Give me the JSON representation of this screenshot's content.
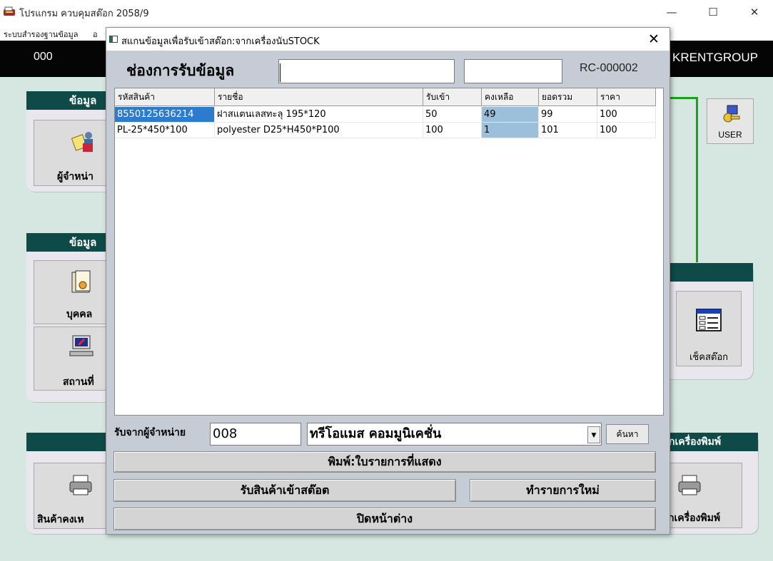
{
  "window": {
    "title": "โปรแกรม ควบคุมสต๊อก 2058/9",
    "minimize": "—",
    "maximize": "☐",
    "close": "✕"
  },
  "menu": [
    "ระบบสำรองฐานข้อมูล",
    "อ"
  ],
  "header_bar": {
    "left_text": "000",
    "right_text": "KRENTGROUP"
  },
  "panels": {
    "panel1": {
      "heading": "ข้อมูล",
      "tile_label": "ผู้จำหน่า"
    },
    "panel2": {
      "heading": "ข้อมูล",
      "tile1_label": "บุคคล",
      "tile2_label": "สถานที่"
    },
    "panel3": {
      "tile_label": "สินค้าคงเห"
    },
    "right_top": {
      "user_label": "USER"
    },
    "right_mid": {
      "tile_label": "เช็คสต๊อก"
    },
    "right_bottom": {
      "heading": "กเครื่องพิมพ์",
      "tile_label": "กเครื่องพิมพ์"
    }
  },
  "dialog": {
    "title": "สแกนข้อมูลเพื่อรับเข้าสต๊อก:จากเครื่องนับSTOCK",
    "close": "✕",
    "scan_label": "ช่องการรับข้อมูล",
    "scan_input": "",
    "qty_input": "",
    "doc_number": "RC-000002",
    "columns": [
      "รหัสสินค้า",
      "รายชื่อ",
      "รับเข้า",
      "คงเหลือ",
      "ยอดรวม",
      "ราคา"
    ],
    "rows": [
      [
        "8550125636214",
        "ฝาสแตนเลสทะลุ 195*120",
        "50",
        "49",
        "99",
        "100"
      ],
      [
        "PL-25*450*100",
        "polyester D25*H450*P100",
        "100",
        "1",
        "101",
        "100"
      ]
    ],
    "supplier_label": "รับจากผู้จำหน่าย",
    "supplier_code": "008",
    "supplier_name": "ทรีโอแมส คอมมูนิเคชั่น",
    "search_button": "ค้นหา",
    "print_button": "พิมพ์:ใบรายการที่แสดง",
    "receive_button": "รับสินค้าเข้าสต๊อต",
    "new_button": "ทำรายการใหม่",
    "close_button": "ปิดหน้าต่าง"
  },
  "colors": {
    "panel_head": "#0e4a48",
    "background": "#d6e6e0",
    "selection": "#2b7bcf",
    "highlight": "#9cc0dc",
    "connector": "#1aa31a"
  }
}
